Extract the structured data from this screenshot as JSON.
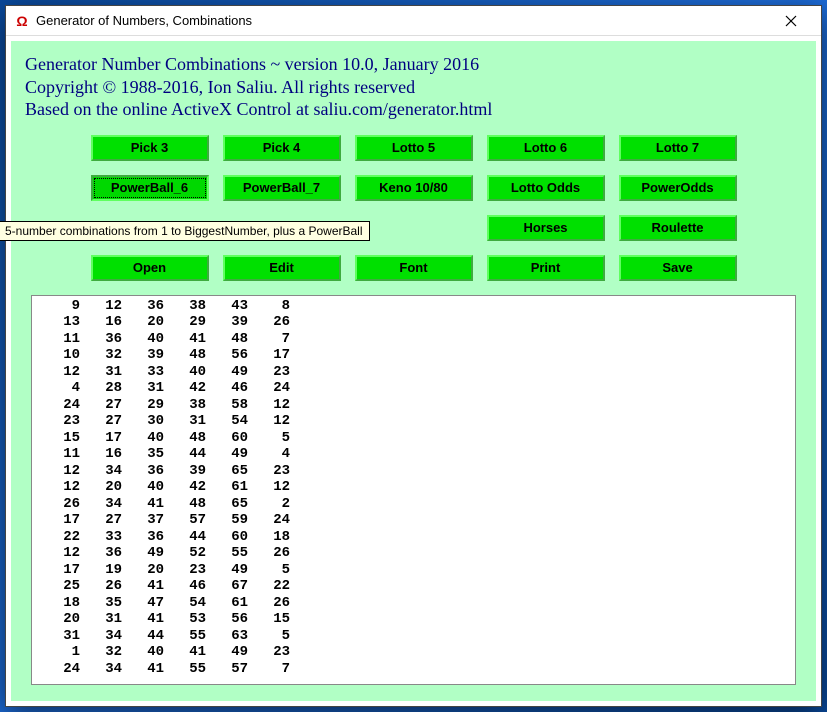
{
  "window": {
    "title": "Generator of Numbers, Combinations"
  },
  "heading": {
    "line1": "Generator Number Combinations ~ version 10.0, January 2016",
    "line2": "Copyright © 1988-2016, Ion Saliu. All rights reserved",
    "line3": "Based on the online ActiveX Control at saliu.com/generator.html"
  },
  "buttons": {
    "row1": [
      "Pick 3",
      "Pick 4",
      "Lotto 5",
      "Lotto 6",
      "Lotto 7"
    ],
    "row2": [
      "PowerBall_6",
      "PowerBall_7",
      "Keno 10/80",
      "Lotto Odds",
      "PowerOdds"
    ],
    "row3": [
      "",
      "",
      "",
      "Horses",
      "Roulette"
    ],
    "row4": [
      "Open",
      "Edit",
      "Font",
      "Print",
      "Save"
    ]
  },
  "tooltip": "5-number combinations from 1 to BiggestNumber, plus a PowerBall",
  "focused_button": "PowerBall_6",
  "output_rows": [
    [
      9,
      12,
      36,
      38,
      43,
      8
    ],
    [
      13,
      16,
      20,
      29,
      39,
      26
    ],
    [
      11,
      36,
      40,
      41,
      48,
      7
    ],
    [
      10,
      32,
      39,
      48,
      56,
      17
    ],
    [
      12,
      31,
      33,
      40,
      49,
      23
    ],
    [
      4,
      28,
      31,
      42,
      46,
      24
    ],
    [
      24,
      27,
      29,
      38,
      58,
      12
    ],
    [
      23,
      27,
      30,
      31,
      54,
      12
    ],
    [
      15,
      17,
      40,
      48,
      60,
      5
    ],
    [
      11,
      16,
      35,
      44,
      49,
      4
    ],
    [
      12,
      34,
      36,
      39,
      65,
      23
    ],
    [
      12,
      20,
      40,
      42,
      61,
      12
    ],
    [
      26,
      34,
      41,
      48,
      65,
      2
    ],
    [
      17,
      27,
      37,
      57,
      59,
      24
    ],
    [
      22,
      33,
      36,
      44,
      60,
      18
    ],
    [
      12,
      36,
      49,
      52,
      55,
      26
    ],
    [
      17,
      19,
      20,
      23,
      49,
      5
    ],
    [
      25,
      26,
      41,
      46,
      67,
      22
    ],
    [
      18,
      35,
      47,
      54,
      61,
      26
    ],
    [
      20,
      31,
      41,
      53,
      56,
      15
    ],
    [
      31,
      34,
      44,
      55,
      63,
      5
    ],
    [
      1,
      32,
      40,
      41,
      49,
      23
    ],
    [
      24,
      34,
      41,
      55,
      57,
      7
    ]
  ]
}
